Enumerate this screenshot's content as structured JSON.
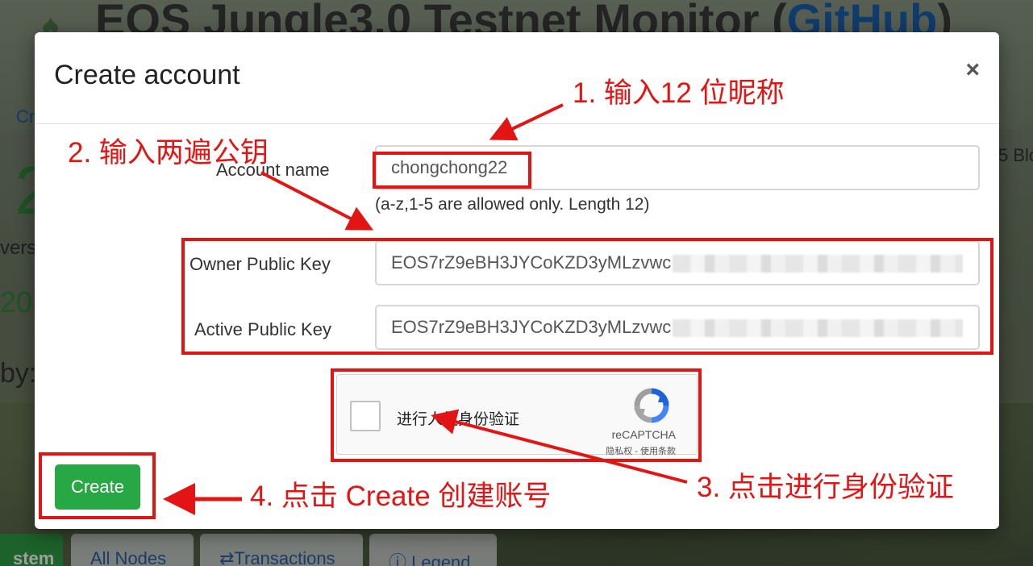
{
  "background": {
    "title_prefix": "EOS Jungle3.0 Testnet Monitor (",
    "title_link": "GitHub",
    "title_suffix": ")",
    "fragments": [
      "Cr",
      "2",
      "vers",
      "20-",
      "by:",
      "5 Blo"
    ],
    "tabs": [
      "stem",
      "All Nodes",
      "⇄Transactions",
      "ⓘ Legend"
    ]
  },
  "modal": {
    "title": "Create account",
    "close_label": "×",
    "account_name": {
      "label": "Account name",
      "value": "chongchong22",
      "hint": "(a-z,1-5 are allowed only. Length 12)"
    },
    "owner_key": {
      "label": "Owner Public Key",
      "value": "EOS7rZ9eBH3JYCoKZD3yMLzvwc"
    },
    "active_key": {
      "label": "Active Public Key",
      "value": "EOS7rZ9eBH3JYCoKZD3yMLzvwc"
    },
    "recaptcha": {
      "text": "进行人机身份验证",
      "brand": "reCAPTCHA",
      "links": "隐私权 - 使用条款"
    },
    "create_label": "Create"
  },
  "annotations": {
    "step1": "1. 输入12 位昵称",
    "step2": "2. 输入两遍公钥",
    "step3": "3. 点击进行身份验证",
    "step4": "4. 点击 Create 创建账号",
    "color": "#e21414"
  },
  "colors": {
    "primary_button": "#28a745",
    "link": "#1b5fb0",
    "annotation": "#e21414"
  }
}
